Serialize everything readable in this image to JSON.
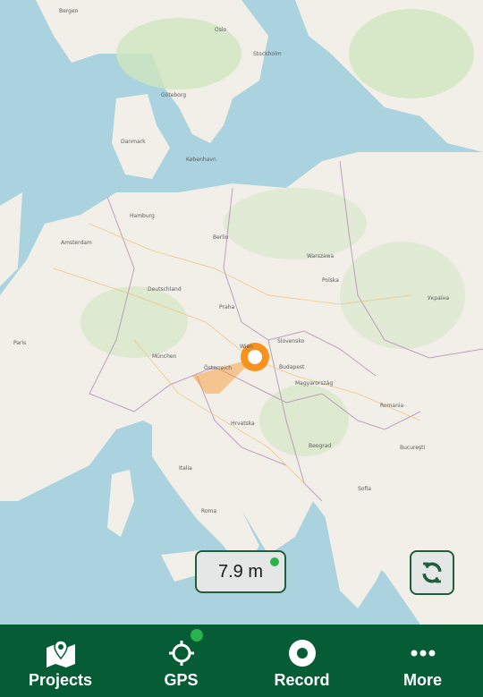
{
  "map": {
    "cities": [
      {
        "name": "Bergen"
      },
      {
        "name": "Oslo"
      },
      {
        "name": "Stockholm"
      },
      {
        "name": "Göteborg"
      },
      {
        "name": "Danmark"
      },
      {
        "name": "København"
      },
      {
        "name": "Hamburg"
      },
      {
        "name": "Berlin"
      },
      {
        "name": "Amsterdam"
      },
      {
        "name": "Warszawa"
      },
      {
        "name": "Praha"
      },
      {
        "name": "Wien"
      },
      {
        "name": "Budapest"
      },
      {
        "name": "Österreich"
      },
      {
        "name": "München"
      },
      {
        "name": "Paris"
      },
      {
        "name": "Beograd"
      },
      {
        "name": "Bucureşti"
      },
      {
        "name": "Sofia"
      },
      {
        "name": "Roma"
      },
      {
        "name": "Polska"
      },
      {
        "name": "Deutschland"
      },
      {
        "name": "Magyarország"
      },
      {
        "name": "Hrvatska"
      },
      {
        "name": "Italia"
      },
      {
        "name": "Slovensko"
      },
      {
        "name": "Romania"
      },
      {
        "name": "Україна"
      }
    ],
    "marker": {
      "accent": "#f7921e"
    }
  },
  "accuracy": {
    "value": "7.9 m",
    "status_color": "#2bb24c"
  },
  "refresh": {
    "icon": "refresh-icon"
  },
  "nav": {
    "items": [
      {
        "label": "Projects",
        "icon": "map-pin-icon"
      },
      {
        "label": "GPS",
        "icon": "crosshair-icon"
      },
      {
        "label": "Record",
        "icon": "record-icon"
      },
      {
        "label": "More",
        "icon": "more-icon"
      }
    ]
  },
  "colors": {
    "brand": "#055c35",
    "sea": "#aad3df",
    "land": "#f2efe9",
    "forest": "#cfe6bf"
  }
}
